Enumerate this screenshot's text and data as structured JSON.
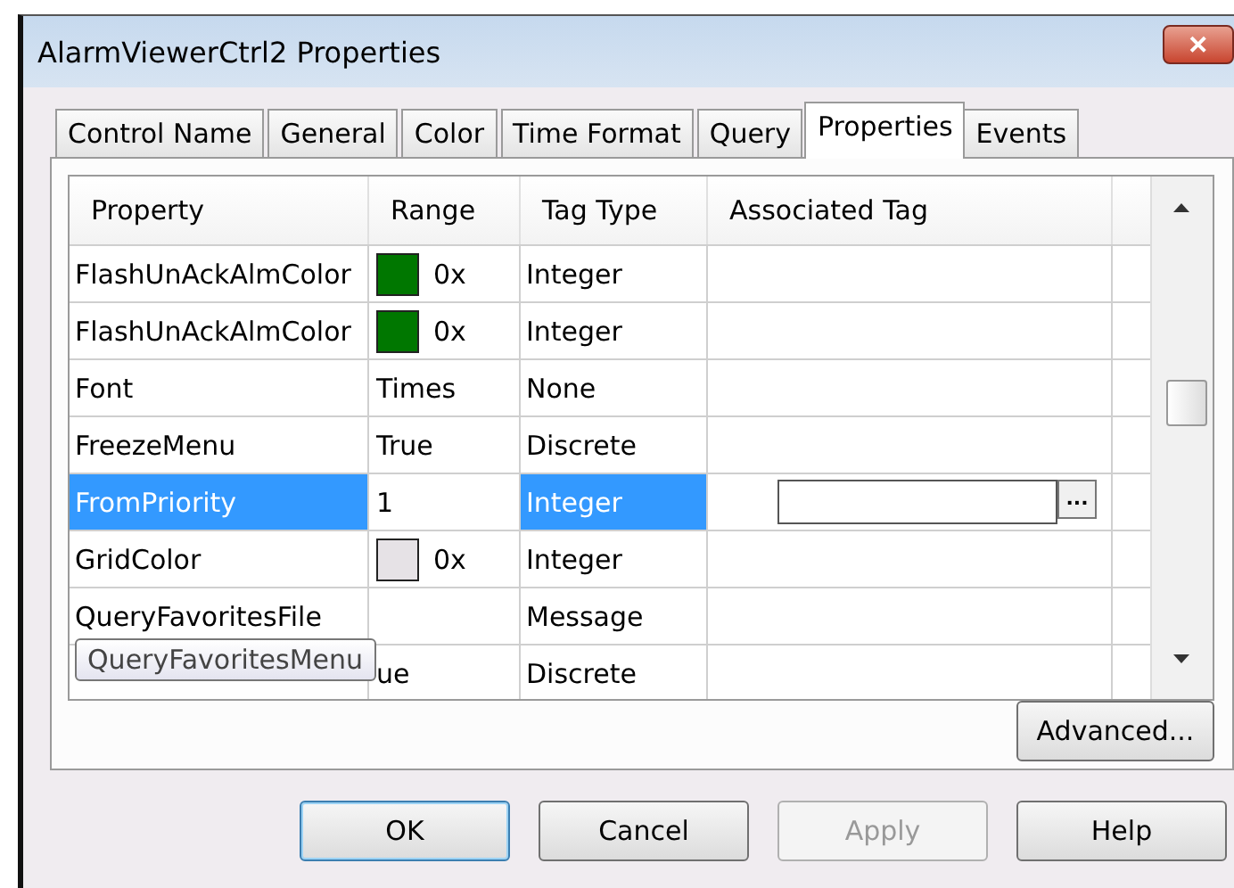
{
  "window": {
    "title": "AlarmViewerCtrl2 Properties",
    "close": "✕"
  },
  "tabs": [
    {
      "label": "Control Name",
      "selected": false
    },
    {
      "label": "General",
      "selected": false
    },
    {
      "label": "Color",
      "selected": false
    },
    {
      "label": "Time Format",
      "selected": false
    },
    {
      "label": "Query",
      "selected": false
    },
    {
      "label": "Properties",
      "selected": true
    },
    {
      "label": "Events",
      "selected": false
    }
  ],
  "table": {
    "columns": [
      "Property",
      "Range",
      "Tag Type",
      "Associated Tag"
    ],
    "rows": [
      {
        "property": "FlashUnAckAlmColor",
        "range": "0x",
        "color": "#007700",
        "tag_type": "Integer",
        "selected": false
      },
      {
        "property": "FlashUnAckAlmColor",
        "range": "0x",
        "color": "#007700",
        "tag_type": "Integer",
        "selected": false
      },
      {
        "property": "Font",
        "range": "Times",
        "tag_type": "None",
        "selected": false
      },
      {
        "property": "FreezeMenu",
        "range": "True",
        "tag_type": "Discrete",
        "selected": false
      },
      {
        "property": "FromPriority",
        "range": "1",
        "tag_type": "Integer",
        "selected": true,
        "editor": {
          "button": "..."
        }
      },
      {
        "property": "GridColor",
        "range": "0x",
        "color": "#e6e2e6",
        "tag_type": "Integer",
        "selected": false
      },
      {
        "property": "QueryFavoritesFile",
        "range": "",
        "tag_type": "Message",
        "selected": false
      },
      {
        "property": "",
        "range": "ue",
        "tag_type": "Discrete",
        "selected": false
      }
    ],
    "tooltip": "QueryFavoritesMenu"
  },
  "advanced_button": "Advanced...",
  "buttons": [
    {
      "label": "OK",
      "kind": "default"
    },
    {
      "label": "Cancel",
      "kind": "normal"
    },
    {
      "label": "Apply",
      "kind": "disabled"
    },
    {
      "label": "Help",
      "kind": "normal"
    }
  ]
}
